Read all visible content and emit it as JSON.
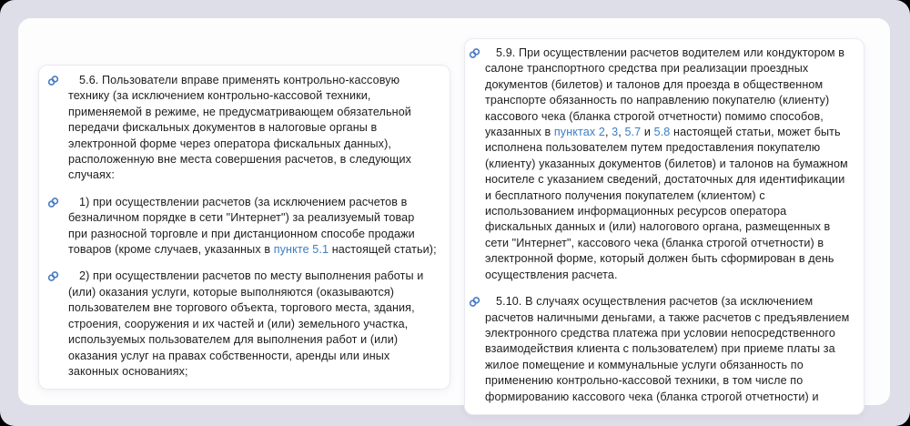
{
  "window": {
    "frame_color": "#dedee9",
    "panel_color": "#fdfdfe",
    "card_color": "#ffffff",
    "text_color": "#1d1d1f",
    "link_color": "#3d7dc6",
    "anchor_icon_color": "#4a7cc2",
    "anchor_icon": "chain-link-icon"
  },
  "columns": [
    {
      "name": "left",
      "paragraphs": [
        {
          "segments": [
            {
              "text": "5.6. Пользователи вправе применять контрольно-кассовую технику (за исключением контрольно-кассовой техники, применяемой в режиме, не предусматривающем обязательной передачи фискальных документов в налоговые органы в электронной форме через оператора фискальных данных), расположенную вне места совершения расчетов, в следующих случаях:"
            }
          ]
        },
        {
          "segments": [
            {
              "text": "1) при осуществлении расчетов (за исключением расчетов в безналичном порядке в сети \"Интернет\") за реализуемый товар при разносной торговле и при дистанционном способе продажи товаров (кроме случаев, указанных в "
            },
            {
              "text": "пункте 5.1",
              "link": true
            },
            {
              "text": " настоящей статьи);"
            }
          ]
        },
        {
          "segments": [
            {
              "text": "2) при осуществлении расчетов по месту выполнения работы и (или) оказания услуги, которые выполняются (оказываются) пользователем вне торгового объекта, торгового места, здания, строения, сооружения и их частей и (или) земельного участка, используемых пользователем для выполнения работ и (или) оказания услуг на правах собственности, аренды или иных законных основаниях;"
            }
          ]
        }
      ]
    },
    {
      "name": "right",
      "paragraphs": [
        {
          "segments": [
            {
              "text": "5.9. При осуществлении расчетов водителем или кондуктором в салоне транспортного средства при реализации проездных документов (билетов) и талонов для проезда в общественном транспорте обязанность по направлению покупателю (клиенту) кассового чека (бланка строгой отчетности) помимо способов, указанных в "
            },
            {
              "text": "пунктах 2",
              "link": true
            },
            {
              "text": ", "
            },
            {
              "text": "3",
              "link": true
            },
            {
              "text": ", "
            },
            {
              "text": "5.7",
              "link": true
            },
            {
              "text": " и "
            },
            {
              "text": "5.8",
              "link": true
            },
            {
              "text": " настоящей статьи, может быть исполнена пользователем путем предоставления покупателю (клиенту) указанных документов (билетов) и талонов на бумажном носителе с указанием сведений, достаточных для идентификации и бесплатного получения покупателем (клиентом) с использованием информационных ресурсов оператора фискальных данных и (или) налогового органа, размещенных в сети \"Интернет\", кассового чека (бланка строгой отчетности) в электронной форме, который должен быть сформирован в день осуществления расчета."
            }
          ]
        },
        {
          "segments": [
            {
              "text": "5.10. В случаях осуществления расчетов (за исключением расчетов наличными деньгами, а также расчетов с предъявлением электронного средства платежа при условии непосредственного взаимодействия клиента с пользователем) при приеме платы за жилое помещение и коммунальные услуги обязанность по применению контрольно-кассовой техники, в том числе по формированию кассового чека (бланка строгой отчетности) и"
            }
          ]
        }
      ]
    }
  ]
}
